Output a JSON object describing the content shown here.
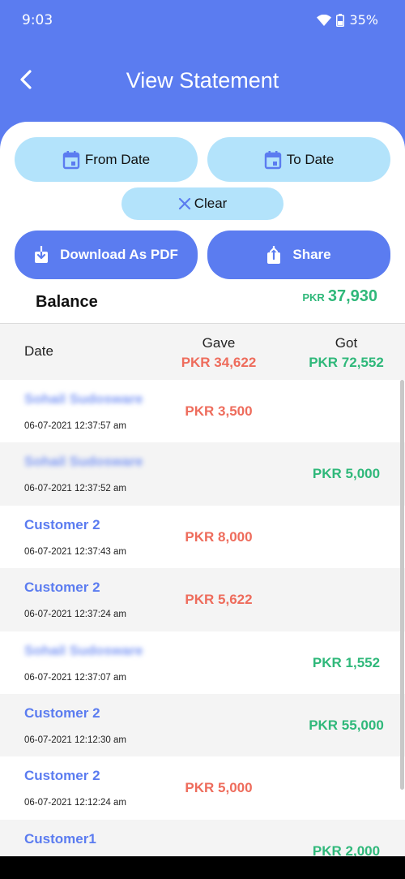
{
  "status": {
    "time": "9:03",
    "battery": "35%"
  },
  "header": {
    "title": "View Statement"
  },
  "filters": {
    "from_date": "From Date",
    "to_date": "To Date",
    "clear": "Clear"
  },
  "actions": {
    "download": "Download As PDF",
    "share": "Share"
  },
  "balance": {
    "label": "Balance",
    "currency": "PKR",
    "amount": "37,930"
  },
  "table": {
    "col_date": "Date",
    "col_gave": "Gave",
    "col_got": "Got",
    "gave_total": "PKR 34,622",
    "got_total": "PKR 72,552"
  },
  "entries": [
    {
      "name": "Sohail Sudosware",
      "time": "06-07-2021 12:37:57 am",
      "gave": "PKR 3,500",
      "got": ""
    },
    {
      "name": "Sohail Sudosware",
      "time": "06-07-2021 12:37:52 am",
      "gave": "",
      "got": "PKR 5,000"
    },
    {
      "name": "Customer 2",
      "time": "06-07-2021 12:37:43 am",
      "gave": "PKR 8,000",
      "got": ""
    },
    {
      "name": "Customer 2",
      "time": "06-07-2021 12:37:24 am",
      "gave": "PKR 5,622",
      "got": ""
    },
    {
      "name": "Sohail Sudosware",
      "time": "06-07-2021 12:37:07 am",
      "gave": "",
      "got": "PKR 1,552"
    },
    {
      "name": "Customer 2",
      "time": "06-07-2021 12:12:30 am",
      "gave": "",
      "got": "PKR 55,000"
    },
    {
      "name": "Customer 2",
      "time": "06-07-2021 12:12:24 am",
      "gave": "PKR 5,000",
      "got": ""
    },
    {
      "name": "Customer1",
      "time": "",
      "gave": "",
      "got": "PKR 2,000"
    }
  ],
  "colors": {
    "primary": "#5b7cf0",
    "light_pill": "#b3e3fb",
    "gave": "#ee6c5c",
    "got": "#2fb87a"
  }
}
